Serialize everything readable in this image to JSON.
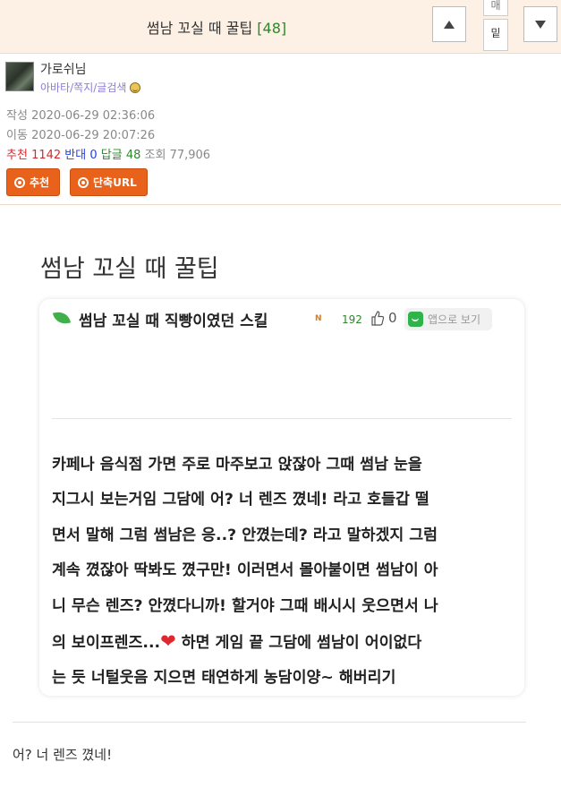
{
  "header": {
    "title": "썸남 꼬실 때 꿀팁",
    "comment_count": "[48]",
    "mini_tab_top": "매",
    "mini_tab_bottom": "밑"
  },
  "author": {
    "nickname": "가로쉬님",
    "links": "아바타/쪽지/글검색"
  },
  "meta": {
    "written_label": "작성",
    "written": "2020-06-29 02:36:06",
    "moved_label": "이동",
    "moved": "2020-06-29 20:07:26",
    "recommend_label": "추천",
    "recommend": "1142",
    "oppose_label": "반대",
    "oppose": "0",
    "replies_label": "답글",
    "replies": "48",
    "views_label": "조회",
    "views": "77,906"
  },
  "buttons": {
    "recommend": "추천",
    "short_url": "단축URL"
  },
  "post": {
    "title": "썸남 꼬실 때 꿀팁",
    "card": {
      "title": "썸남 꼬실 때 직빵이였던 스킬",
      "badge": "N",
      "views": "192",
      "likes": "0",
      "app_view": "앱으로 보기",
      "text_before_heart": "카페나 음식점 가면 주로 마주보고 앉잖아 그때 썸남 눈을\n지그시 보는거임 그담에 어? 너 렌즈 꼈네! 라고 호들갑 떨\n면서 말해 그럼 썸남은 응..? 안꼈는데? 라고 말하겠지 그럼\n계속 꼈잖아 딱봐도 꼈구만! 이러면서 몰아붙이면 썸남이 아\n니 무슨 렌즈? 안꼈다니까! 할거야 그때 배시시 웃으면서 나\n의 보이프렌즈...",
      "text_after_heart": " 하면 게임 끝 그담에 썸남이 어이없다\n는 듯 너털웃음 지으면 태연하게 농담이양~ 해버리기"
    },
    "caption": "어? 너 렌즈 꼈네!"
  },
  "colors": {
    "header_bg": "#fdf0e5",
    "button_orange": "#e8621b",
    "recommend_red": "#d9272e",
    "oppose_blue": "#2a3fd6",
    "reply_green": "#2a8a2a",
    "heart_red": "#e0262e"
  },
  "icons": {
    "up": "triangle-up-icon",
    "down": "triangle-down-icon",
    "smile": "smile-icon",
    "leaf": "leaf-icon",
    "thumb": "thumbs-up-icon",
    "app": "app-icon",
    "heart": "heart-icon"
  }
}
